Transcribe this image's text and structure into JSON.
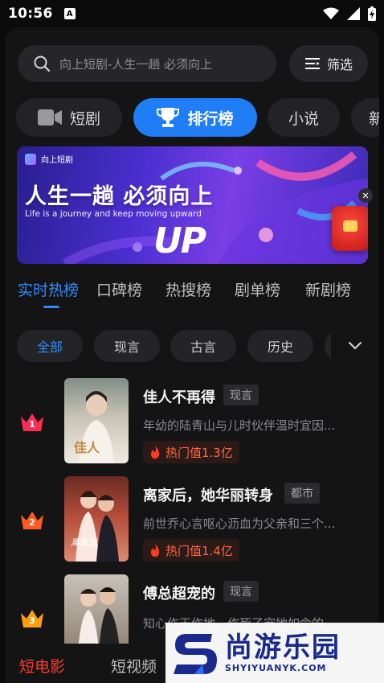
{
  "status": {
    "time": "10:56",
    "notification_glyph": "A"
  },
  "search": {
    "placeholder": "向上短剧-人生一趟 必须向上"
  },
  "filter": {
    "label": "筛选"
  },
  "categories": [
    {
      "label": "短剧",
      "icon": "video-camera-icon"
    },
    {
      "label": "排行榜",
      "icon": "trophy-icon",
      "active": true
    },
    {
      "label": "小说"
    },
    {
      "label": "新"
    }
  ],
  "banner": {
    "brand": "向上短剧",
    "title": "人生一趟  必须向上",
    "subtitle": "Life is a journey and  keep moving upward",
    "up_text": "UP"
  },
  "rank_tabs": [
    "实时热榜",
    "口碑榜",
    "热搜榜",
    "剧单榜",
    "新剧榜"
  ],
  "genres": [
    "全部",
    "现言",
    "古言",
    "历史"
  ],
  "list": [
    {
      "rank": "1",
      "title": "佳人不再得",
      "tag": "现言",
      "desc": "年幼的陆青山与儿时伙伴温时宜因...",
      "heat": "热门值1.3亿",
      "crown_color": "#ff2d55"
    },
    {
      "rank": "2",
      "title": "离家后，她华丽转身",
      "tag": "都市",
      "desc": "前世乔心言呕心沥血为父亲和三个...",
      "heat": "热门值1.4亿",
      "crown_color": "#ff5a1f"
    },
    {
      "rank": "3",
      "title": "傅总超宠的",
      "tag": "现言",
      "desc": "知心作天作地，作死了宠她如命的...",
      "crown_color": "#ff9f0a"
    }
  ],
  "bottom_tabs": [
    "短电影",
    "短视频"
  ],
  "watermark": {
    "cn": "尚游乐园",
    "en": "SHYIYUANYK.COM"
  },
  "colors": {
    "accent_blue": "#1f7df5",
    "accent_red": "#ff3b30",
    "heat_orange": "#ff6a3d"
  }
}
